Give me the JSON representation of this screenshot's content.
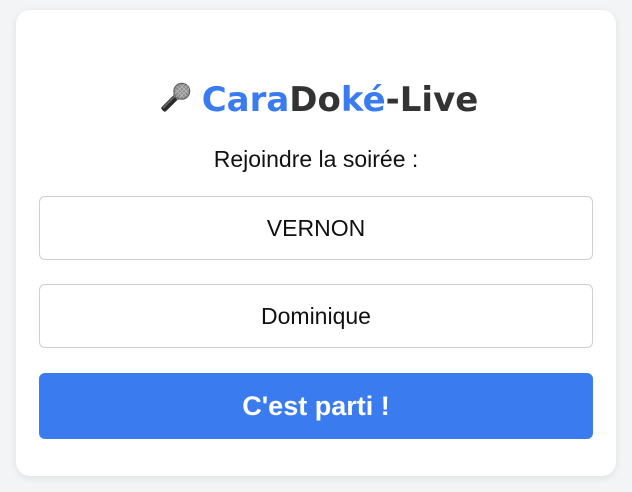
{
  "app": {
    "title_part1": "Cara",
    "title_part2": "Do",
    "title_part3": "ké",
    "title_part4": "-Live",
    "mic_icon": "microphone-icon"
  },
  "join": {
    "prompt": "Rejoindre la soirée :",
    "room_value": "VERNON",
    "name_value": "Dominique",
    "submit_label": "C'est parti !"
  },
  "colors": {
    "accent": "#3a7bf0",
    "text_dark": "#333333",
    "page_bg": "#f2f4f5",
    "card_bg": "#ffffff"
  }
}
